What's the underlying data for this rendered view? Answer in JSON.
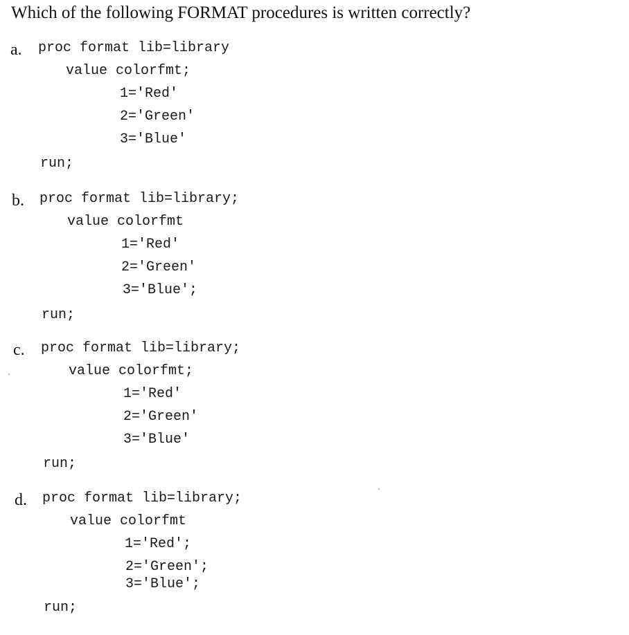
{
  "question": "Which of the following FORMAT procedures is written correctly?",
  "options": [
    {
      "letter": "a.",
      "proc": "proc format lib=library",
      "value": "value colorfmt;",
      "lines": [
        "1='Red'",
        "2='Green'",
        "3='Blue'"
      ],
      "run": "run;"
    },
    {
      "letter": "b.",
      "proc": "proc format lib=library;",
      "value": "value colorfmt",
      "lines": [
        "1='Red'",
        "2='Green'",
        "3='Blue';"
      ],
      "run": "run;"
    },
    {
      "letter": "c.",
      "proc": "proc format lib=library;",
      "value": "value colorfmt;",
      "lines": [
        "1='Red'",
        "2='Green'",
        "3='Blue'"
      ],
      "run": "run;"
    },
    {
      "letter": "d.",
      "proc": "proc format lib=library;",
      "value": "value colorfmt",
      "lines": [
        "1='Red';",
        "2='Green';",
        "3='Blue';"
      ],
      "run": "run;"
    }
  ]
}
